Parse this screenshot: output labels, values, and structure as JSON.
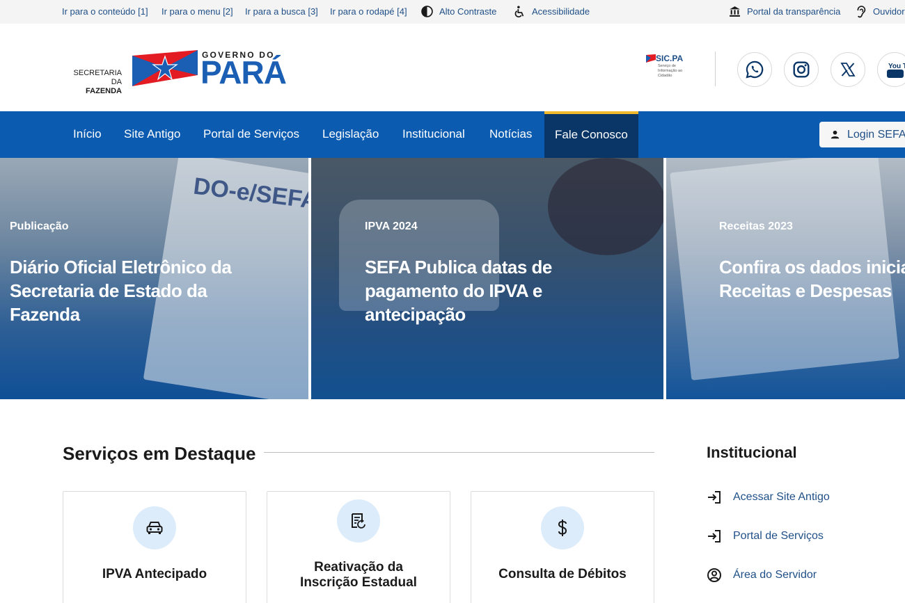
{
  "topbar": {
    "skip_links": [
      "Ir para o conteúdo [1]",
      "Ir para o menu [2]",
      "Ir para a busca [3]",
      "Ir para o rodapé [4]"
    ],
    "high_contrast": "Alto Contraste",
    "accessibility": "Acessibilidade",
    "transparency": "Portal da transparência",
    "ombudsman": "Ouvidoria"
  },
  "header": {
    "sefa_line1": "SECRETARIA DA",
    "sefa_line2": "FAZENDA",
    "gov_small": "GOVERNO DO",
    "gov_big": "PARÁ",
    "sic_title": "SIC.PA",
    "sic_sub": "Serviço de Informação ao Cidadão",
    "social_icons": [
      "whatsapp-icon",
      "instagram-icon",
      "x-icon",
      "youtube-icon"
    ],
    "youtube_text": "You Tube"
  },
  "nav": {
    "items": [
      "Início",
      "Site Antigo",
      "Portal de Serviços",
      "Legislação",
      "Institucional",
      "Notícias",
      "Fale Conosco"
    ],
    "active": "Fale Conosco",
    "login": "Login SEFA"
  },
  "banners": [
    {
      "category": "Publicação",
      "title_lines": [
        "Diário Oficial Eletrônico da",
        "Secretaria de Estado da",
        "Fazenda"
      ],
      "masthead": "DO-e/SEFA"
    },
    {
      "category": "IPVA 2024",
      "title_lines": [
        "SEFA Publica datas de",
        "pagamento do IPVA e",
        "antecipação"
      ]
    },
    {
      "category": "Receitas 2023",
      "title_lines": [
        "Confira os dados iniciais de",
        "Receitas e Despesas"
      ]
    }
  ],
  "services": {
    "title": "Serviços em Destaque",
    "cards": [
      {
        "label_lines": [
          "IPVA Antecipado"
        ],
        "icon": "car-icon"
      },
      {
        "label_lines": [
          "Reativação da",
          "Inscrição Estadual"
        ],
        "icon": "receipt-icon"
      },
      {
        "label_lines": [
          "Consulta de Débitos"
        ],
        "icon": "dollar-icon"
      }
    ]
  },
  "institucional": {
    "title": "Institucional",
    "items": [
      {
        "label": "Acessar Site Antigo",
        "icon": "login-arrow-icon"
      },
      {
        "label": "Portal de Serviços",
        "icon": "login-arrow-icon"
      },
      {
        "label": "Área do Servidor",
        "icon": "user-circle-icon"
      }
    ]
  },
  "colors": {
    "nav_bg": "#0b5cb1",
    "nav_active_bg": "#0a3567",
    "nav_active_border": "#f3b92c",
    "link": "#1f4f88",
    "icon_bg": "#dcecfb",
    "gov_blue": "#1a5fb4",
    "gov_red": "#e31b23"
  }
}
